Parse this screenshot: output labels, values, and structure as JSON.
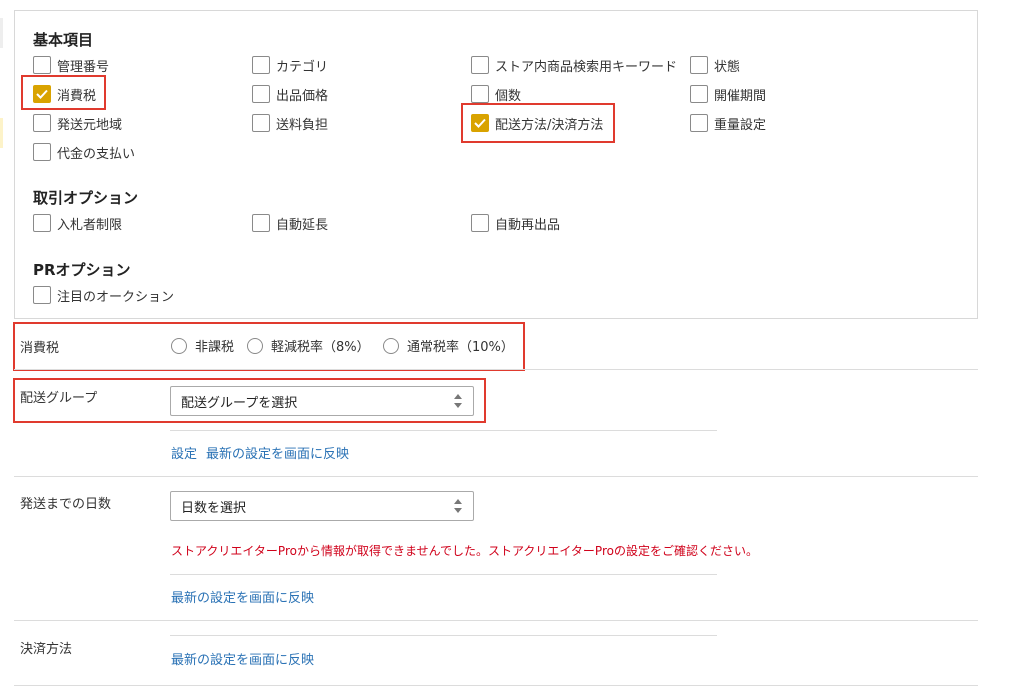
{
  "basic": {
    "title": "基本項目",
    "items": [
      {
        "label": "管理番号",
        "checked": false
      },
      {
        "label": "カテゴリ",
        "checked": false
      },
      {
        "label": "ストア内商品検索用キーワード",
        "checked": false
      },
      {
        "label": "状態",
        "checked": false
      },
      {
        "label": "消費税",
        "checked": true
      },
      {
        "label": "出品価格",
        "checked": false
      },
      {
        "label": "個数",
        "checked": false
      },
      {
        "label": "開催期間",
        "checked": false
      },
      {
        "label": "発送元地域",
        "checked": false
      },
      {
        "label": "送料負担",
        "checked": false
      },
      {
        "label": "配送方法/決済方法",
        "checked": true
      },
      {
        "label": "重量設定",
        "checked": false
      },
      {
        "label": "代金の支払い",
        "checked": false
      }
    ]
  },
  "trade": {
    "title": "取引オプション",
    "items": [
      {
        "label": "入札者制限",
        "checked": false
      },
      {
        "label": "自動延長",
        "checked": false
      },
      {
        "label": "自動再出品",
        "checked": false
      }
    ]
  },
  "pr": {
    "title": "PRオプション",
    "items": [
      {
        "label": "注目のオークション",
        "checked": false
      }
    ]
  },
  "tax": {
    "label": "消費税",
    "options": [
      "非課税",
      "軽減税率（8%）",
      "通常税率（10%）"
    ]
  },
  "shipping_group": {
    "label": "配送グループ",
    "select_value": "配送グループを選択",
    "link_settings": "設定",
    "link_reflect": "最新の設定を画面に反映"
  },
  "ship_days": {
    "label": "発送までの日数",
    "select_value": "日数を選択",
    "error": "ストアクリエイターProから情報が取得できませんでした。ストアクリエイターProの設定をご確認ください。",
    "link_reflect": "最新の設定を画面に反映"
  },
  "payment": {
    "label": "決済方法",
    "link_reflect": "最新の設定を画面に反映"
  },
  "colors": {
    "accent_check": "#d9a300",
    "highlight": "#e03a2e",
    "link": "#2a72b5",
    "error": "#d0021b"
  }
}
